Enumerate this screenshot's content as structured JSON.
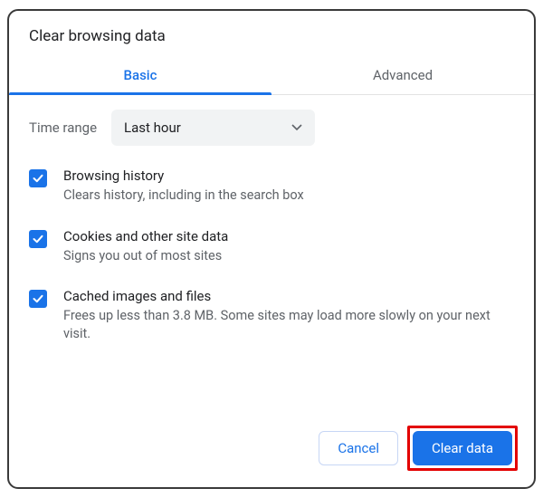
{
  "dialog": {
    "title": "Clear browsing data"
  },
  "tabs": {
    "basic": "Basic",
    "advanced": "Advanced",
    "active": "basic"
  },
  "timerange": {
    "label": "Time range",
    "selected": "Last hour"
  },
  "options": [
    {
      "title": "Browsing history",
      "description": "Clears history, including in the search box",
      "checked": true
    },
    {
      "title": "Cookies and other site data",
      "description": "Signs you out of most sites",
      "checked": true
    },
    {
      "title": "Cached images and files",
      "description": "Frees up less than 3.8 MB. Some sites may load more slowly on your next visit.",
      "checked": true
    }
  ],
  "buttons": {
    "cancel": "Cancel",
    "clear": "Clear data"
  },
  "colors": {
    "accent": "#1a73e8",
    "highlight": "#e30000"
  }
}
